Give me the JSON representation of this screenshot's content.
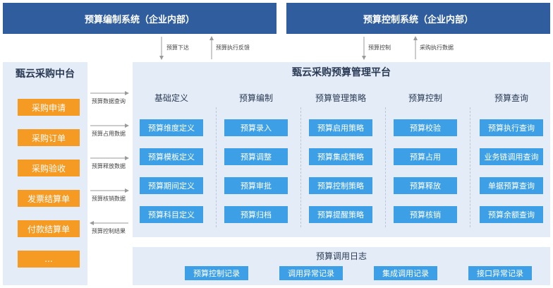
{
  "banners": {
    "left": "预算编制系统（企业内部）",
    "right": "预算控制系统（企业内部）"
  },
  "top_flows": {
    "down": "预算下达",
    "up": "预算执行反馈",
    "control": "预算控制",
    "collect": "采购执行数据"
  },
  "left": {
    "title": "甄云采购中台",
    "items": [
      "采购申请",
      "采购订单",
      "采购验收",
      "发票结算单",
      "付款结算单",
      "..."
    ]
  },
  "flows": [
    "预算数据查询",
    "预算占用数据",
    "预算释放数据",
    "预算核销数据",
    "预算控制结果"
  ],
  "main": {
    "title": "甄云采购预算管理平台",
    "columns": [
      {
        "title": "基础定义",
        "items": [
          "预算维度定义",
          "预算模板定义",
          "预算期间定义",
          "预算科目定义"
        ]
      },
      {
        "title": "预算编制",
        "items": [
          "预算录入",
          "预算调整",
          "预算审批",
          "预算归档"
        ]
      },
      {
        "title": "预算管理策略",
        "items": [
          "预算启用策略",
          "预算集成策略",
          "预算控制策略",
          "预算提醒策略"
        ]
      },
      {
        "title": "预算控制",
        "items": [
          "预算校验",
          "预算占用",
          "预算释放",
          "预算核销"
        ]
      },
      {
        "title": "预算查询",
        "items": [
          "预算执行查询",
          "业务链调用查询",
          "单据预算查询",
          "预算余额查询"
        ]
      }
    ]
  },
  "log": {
    "title": "预算调用日志",
    "items": [
      "预算控制记录",
      "调用异常记录",
      "集成调用记录",
      "接口异常记录"
    ]
  },
  "colors": {
    "banner": "#2f5d9e",
    "panel": "#e4edf7",
    "orange": "#f59a22",
    "blue": "#3da0e6"
  }
}
